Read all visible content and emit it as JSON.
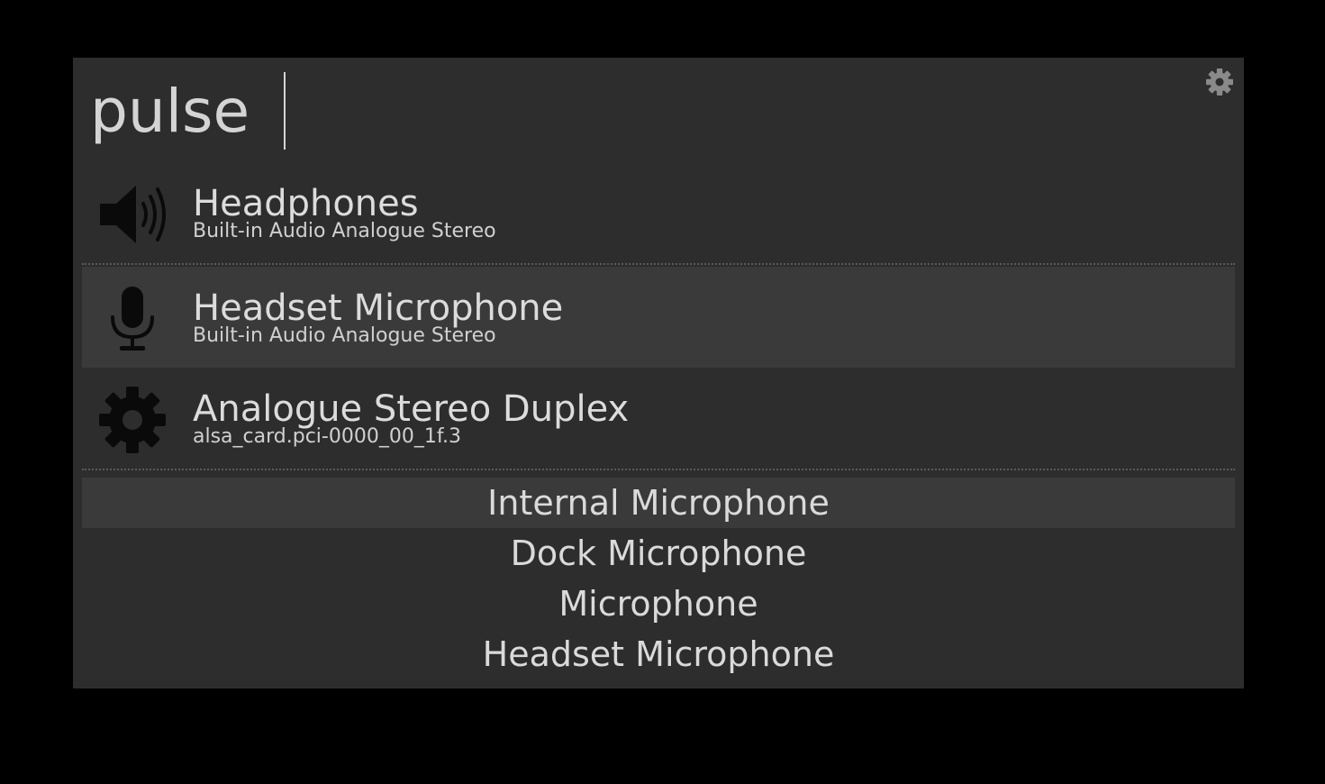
{
  "search": {
    "query": "pulse"
  },
  "settings": {
    "icon": "gear-icon"
  },
  "results": [
    {
      "title": "Headphones",
      "subtitle": "Built-in Audio Analogue Stereo",
      "icon": "speaker-icon",
      "selected": false
    },
    {
      "title": "Headset Microphone",
      "subtitle": "Built-in Audio Analogue Stereo",
      "icon": "microphone-icon",
      "selected": true
    },
    {
      "title": "Analogue Stereo Duplex",
      "subtitle": "alsa_card.pci-0000_00_1f.3",
      "icon": "gear-icon",
      "selected": false
    }
  ],
  "actions": [
    {
      "label": "Internal Microphone",
      "selected": true
    },
    {
      "label": "Dock Microphone",
      "selected": false
    },
    {
      "label": "Microphone",
      "selected": false
    },
    {
      "label": "Headset Microphone",
      "selected": false
    }
  ],
  "colors": {
    "background": "#000000",
    "panel": "#2d2d2d",
    "selected": "#3a3a3a",
    "text": "#d8d8d8",
    "icon": "#0a0a0a",
    "settings_icon": "#8a8a8a"
  }
}
